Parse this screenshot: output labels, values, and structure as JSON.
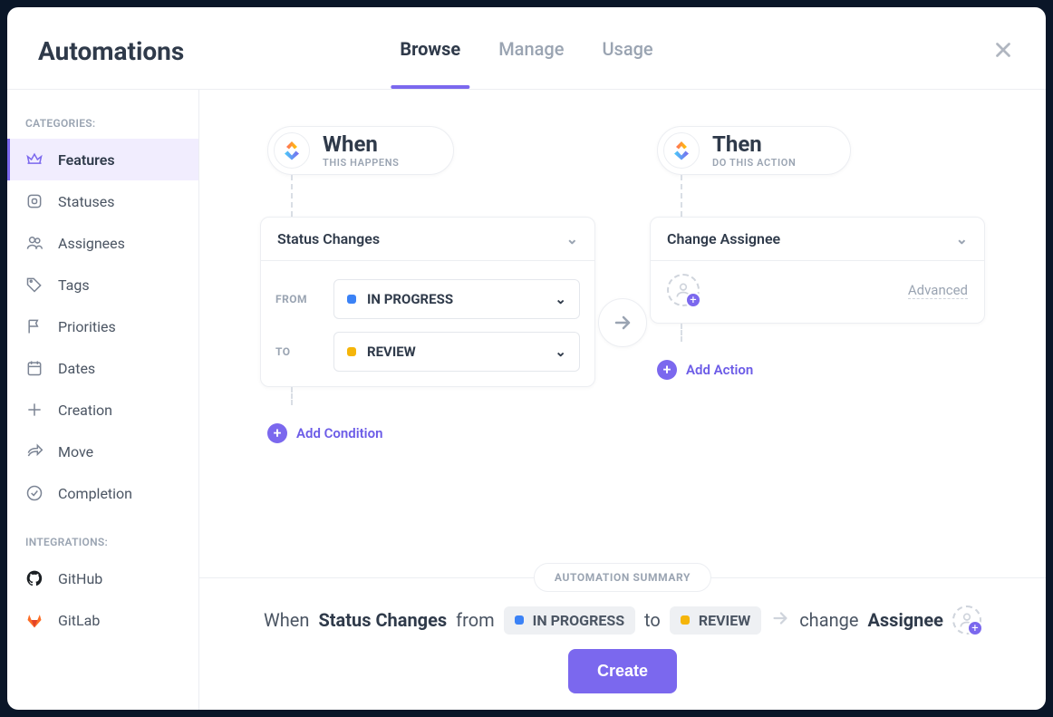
{
  "title": "Automations",
  "tabs": [
    {
      "label": "Browse",
      "active": true
    },
    {
      "label": "Manage",
      "active": false
    },
    {
      "label": "Usage",
      "active": false
    }
  ],
  "sidebar": {
    "sections": [
      {
        "label": "CATEGORIES:",
        "items": [
          {
            "id": "features",
            "label": "Features",
            "active": true
          },
          {
            "id": "statuses",
            "label": "Statuses"
          },
          {
            "id": "assignees",
            "label": "Assignees"
          },
          {
            "id": "tags",
            "label": "Tags"
          },
          {
            "id": "priorities",
            "label": "Priorities"
          },
          {
            "id": "dates",
            "label": "Dates"
          },
          {
            "id": "creation",
            "label": "Creation"
          },
          {
            "id": "move",
            "label": "Move"
          },
          {
            "id": "completion",
            "label": "Completion"
          }
        ]
      },
      {
        "label": "INTEGRATIONS:",
        "items": [
          {
            "id": "github",
            "label": "GitHub"
          },
          {
            "id": "gitlab",
            "label": "GitLab"
          }
        ]
      }
    ]
  },
  "when": {
    "title": "When",
    "subtitle": "THIS HAPPENS",
    "trigger": "Status Changes",
    "from_label": "FROM",
    "from_status": {
      "name": "IN PROGRESS",
      "color": "#3b82f6"
    },
    "to_label": "TO",
    "to_status": {
      "name": "REVIEW",
      "color": "#f5b50a"
    },
    "add_condition": "Add Condition"
  },
  "then": {
    "title": "Then",
    "subtitle": "DO THIS ACTION",
    "action": "Change Assignee",
    "advanced": "Advanced",
    "add_action": "Add Action"
  },
  "summary": {
    "badge": "AUTOMATION SUMMARY",
    "text": {
      "when": "When",
      "status_changes": "Status Changes",
      "from": "from",
      "to": "to",
      "change": "change",
      "assignee": "Assignee"
    },
    "create": "Create"
  }
}
